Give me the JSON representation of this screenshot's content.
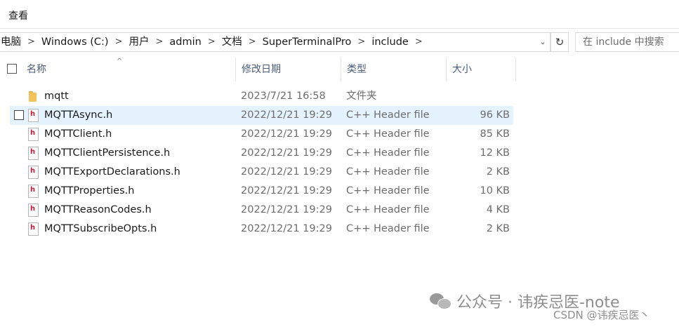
{
  "ribbon": {
    "tab_view": "查看"
  },
  "address": {
    "crumbs": [
      "电脑",
      "Windows (C:)",
      "用户",
      "admin",
      "文档",
      "SuperTerminalPro",
      "include"
    ],
    "separator": ">",
    "dropdown_glyph": "⌄",
    "refresh_glyph": "↻"
  },
  "search": {
    "placeholder": "在 include 中搜索"
  },
  "columns": {
    "name": "名称",
    "date": "修改日期",
    "type": "类型",
    "size": "大小",
    "sort_glyph": "^"
  },
  "files": [
    {
      "name": "mqtt",
      "date": "2023/7/21 16:58",
      "type": "文件夹",
      "size": "",
      "icon": "folder-icon"
    },
    {
      "name": "MQTTAsync.h",
      "date": "2022/12/21 19:29",
      "type": "C++ Header file",
      "size": "96 KB",
      "icon": "header-file-icon"
    },
    {
      "name": "MQTTClient.h",
      "date": "2022/12/21 19:29",
      "type": "C++ Header file",
      "size": "85 KB",
      "icon": "header-file-icon"
    },
    {
      "name": "MQTTClientPersistence.h",
      "date": "2022/12/21 19:29",
      "type": "C++ Header file",
      "size": "12 KB",
      "icon": "header-file-icon"
    },
    {
      "name": "MQTTExportDeclarations.h",
      "date": "2022/12/21 19:29",
      "type": "C++ Header file",
      "size": "2 KB",
      "icon": "header-file-icon"
    },
    {
      "name": "MQTTProperties.h",
      "date": "2022/12/21 19:29",
      "type": "C++ Header file",
      "size": "10 KB",
      "icon": "header-file-icon"
    },
    {
      "name": "MQTTReasonCodes.h",
      "date": "2022/12/21 19:29",
      "type": "C++ Header file",
      "size": "4 KB",
      "icon": "header-file-icon"
    },
    {
      "name": "MQTTSubscribeOpts.h",
      "date": "2022/12/21 19:29",
      "type": "C++ Header file",
      "size": "2 KB",
      "icon": "header-file-icon"
    }
  ],
  "file_icon_letter": "h",
  "hover_row_index": 1,
  "colors": {
    "hover": "#e5f3ff",
    "header_text": "#4a5d7a",
    "folder": "#f3c35a",
    "header_file_red": "#c0203c"
  },
  "watermark": {
    "wechat": "公众号 · 讳疾忌医-note",
    "csdn": "CSDN @讳疾忌医丶"
  }
}
